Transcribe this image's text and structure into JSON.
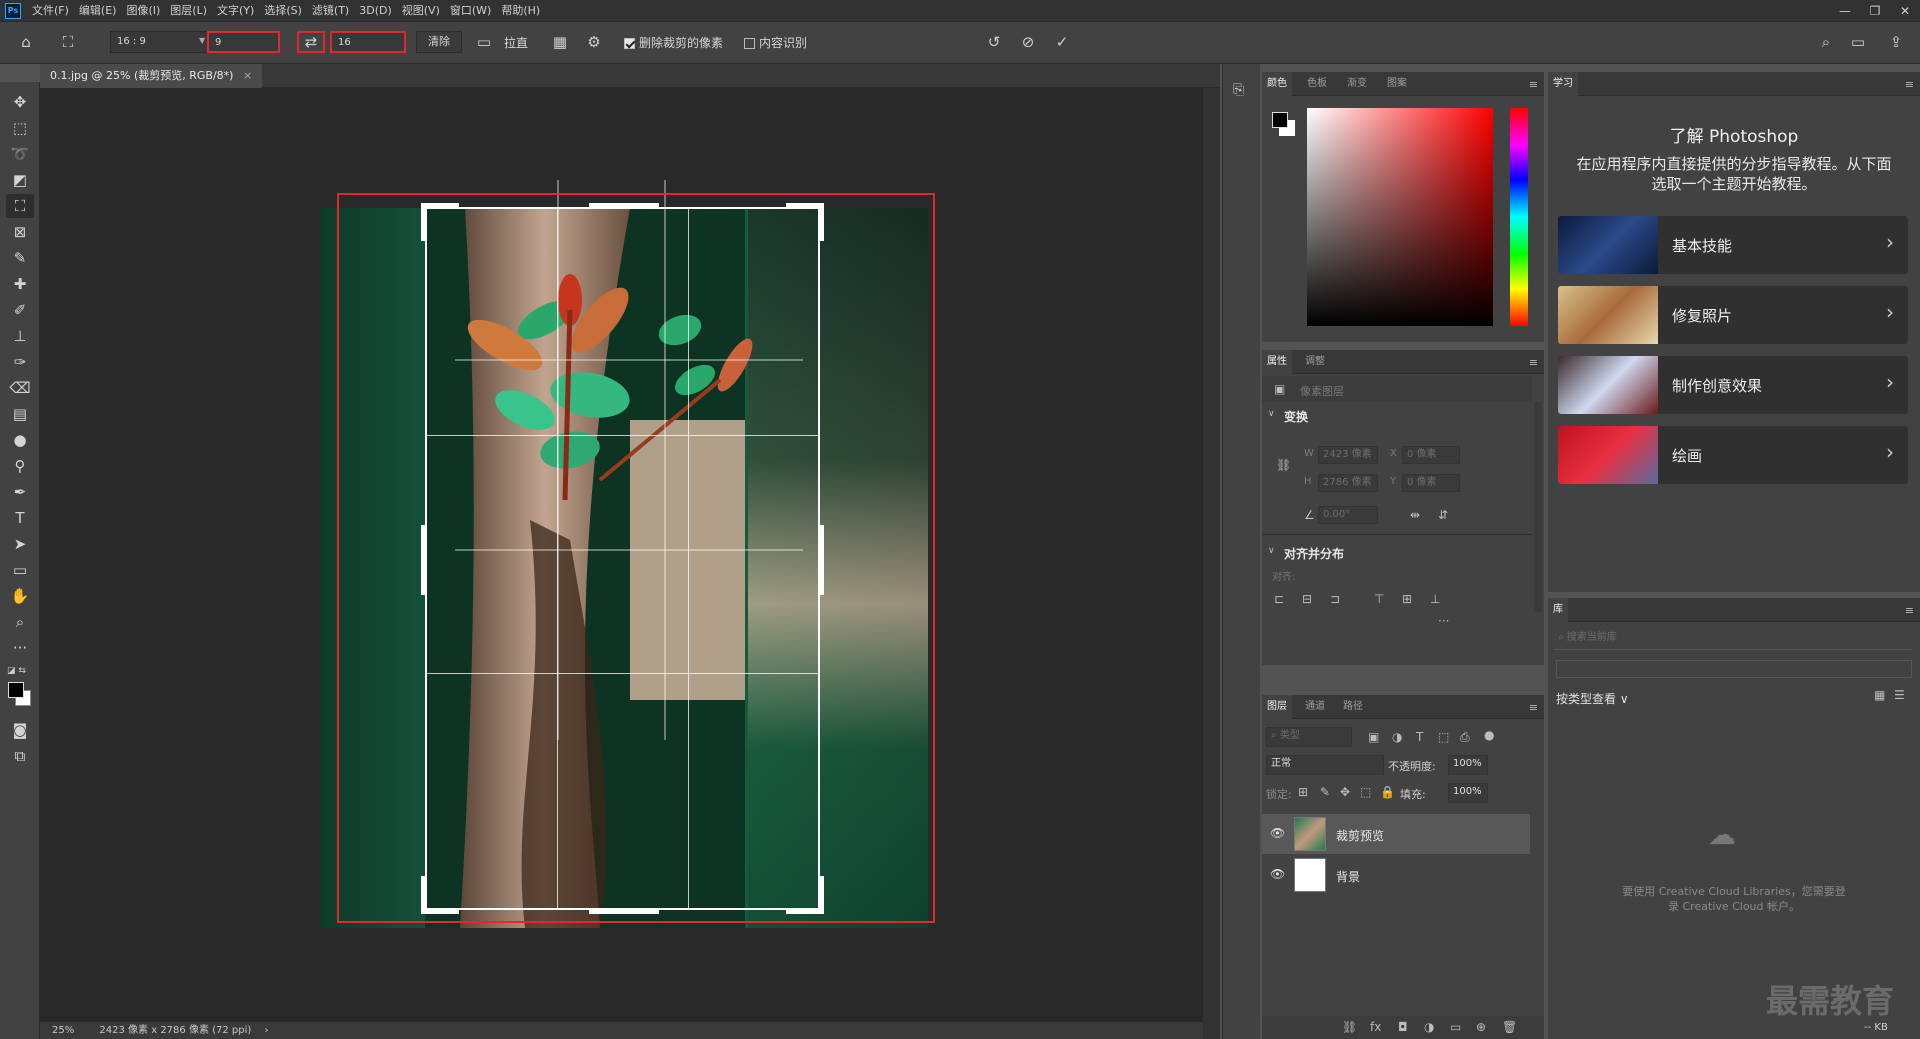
{
  "app": {
    "logo": "Ps"
  },
  "menu": [
    "文件(F)",
    "编辑(E)",
    "图像(I)",
    "图层(L)",
    "文字(Y)",
    "选择(S)",
    "滤镜(T)",
    "3D(D)",
    "视图(V)",
    "窗口(W)",
    "帮助(H)"
  ],
  "window_controls": [
    "—",
    "❐",
    "✕"
  ],
  "options": {
    "ratio_preset": "16 : 9",
    "width_value": "9",
    "height_value": "16",
    "clear_label": "清除",
    "straighten_label": "拉直",
    "delete_cropped_label": "删除裁剪的像素",
    "delete_cropped_checked": true,
    "content_aware_label": "内容识别",
    "content_aware_checked": false
  },
  "document": {
    "tab_title": "0.1.jpg @ 25% (裁剪预览, RGB/8*)",
    "zoom": "25%",
    "info": "2423 像素 x 2786 像素 (72 ppi)"
  },
  "color_panel": {
    "tabs": [
      "颜色",
      "色板",
      "渐变",
      "图案"
    ],
    "selected_tab": 0
  },
  "properties_panel": {
    "tabs": [
      "属性",
      "调整"
    ],
    "layer_type": "像素图层",
    "transform_title": "变换",
    "w_label": "W",
    "w_value": "2423 像素",
    "h_label": "H",
    "h_value": "2786 像素",
    "x_label": "X",
    "x_value": "0 像素",
    "y_label": "Y",
    "y_value": "0 像素",
    "angle_value": "0.00°",
    "align_title": "对齐并分布",
    "align_label": "对齐:"
  },
  "layers_panel": {
    "tabs": [
      "图层",
      "通道",
      "路径"
    ],
    "filter_placeholder": "类型",
    "blend_mode": "正常",
    "opacity_label": "不透明度:",
    "opacity_value": "100%",
    "lock_label": "锁定:",
    "fill_label": "填充:",
    "fill_value": "100%",
    "layers": [
      {
        "name": "裁剪预览",
        "selected": true
      },
      {
        "name": "背景",
        "selected": false
      }
    ]
  },
  "learn_panel": {
    "tab": "学习",
    "title": "了解 Photoshop",
    "description": "在应用程序内直接提供的分步指导教程。从下面选取一个主题开始教程。",
    "cards": [
      {
        "label": "基本技能"
      },
      {
        "label": "修复照片"
      },
      {
        "label": "制作创意效果"
      },
      {
        "label": "绘画"
      }
    ]
  },
  "library_panel": {
    "tab": "库",
    "search_placeholder": "搜索当前库",
    "view_label": "按类型查看",
    "message": "要使用 Creative Cloud Libraries，您需要登录 Creative Cloud 帐户。",
    "size_label": "-- KB"
  },
  "watermark": "最需教育",
  "colors": {
    "accent_red": "#e0282d",
    "panel_bg": "#424242",
    "canvas_bg": "#282828"
  }
}
